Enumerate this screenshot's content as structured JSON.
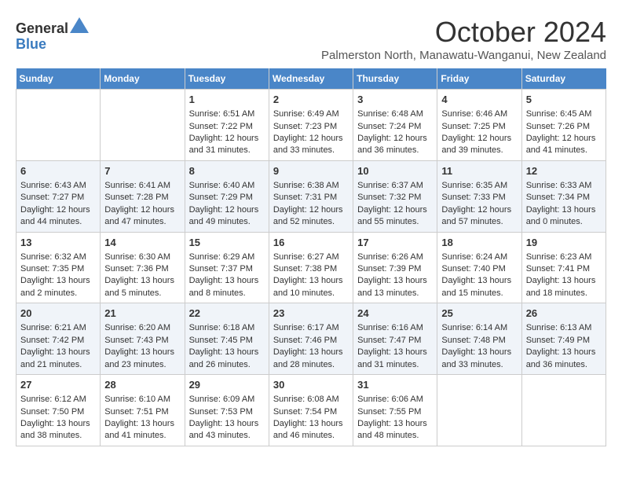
{
  "logo": {
    "general": "General",
    "blue": "Blue"
  },
  "title": "October 2024",
  "location": "Palmerston North, Manawatu-Wanganui, New Zealand",
  "days_of_week": [
    "Sunday",
    "Monday",
    "Tuesday",
    "Wednesday",
    "Thursday",
    "Friday",
    "Saturday"
  ],
  "weeks": [
    [
      {
        "day": "",
        "sunrise": "",
        "sunset": "",
        "daylight": ""
      },
      {
        "day": "",
        "sunrise": "",
        "sunset": "",
        "daylight": ""
      },
      {
        "day": "1",
        "sunrise": "Sunrise: 6:51 AM",
        "sunset": "Sunset: 7:22 PM",
        "daylight": "Daylight: 12 hours and 31 minutes."
      },
      {
        "day": "2",
        "sunrise": "Sunrise: 6:49 AM",
        "sunset": "Sunset: 7:23 PM",
        "daylight": "Daylight: 12 hours and 33 minutes."
      },
      {
        "day": "3",
        "sunrise": "Sunrise: 6:48 AM",
        "sunset": "Sunset: 7:24 PM",
        "daylight": "Daylight: 12 hours and 36 minutes."
      },
      {
        "day": "4",
        "sunrise": "Sunrise: 6:46 AM",
        "sunset": "Sunset: 7:25 PM",
        "daylight": "Daylight: 12 hours and 39 minutes."
      },
      {
        "day": "5",
        "sunrise": "Sunrise: 6:45 AM",
        "sunset": "Sunset: 7:26 PM",
        "daylight": "Daylight: 12 hours and 41 minutes."
      }
    ],
    [
      {
        "day": "6",
        "sunrise": "Sunrise: 6:43 AM",
        "sunset": "Sunset: 7:27 PM",
        "daylight": "Daylight: 12 hours and 44 minutes."
      },
      {
        "day": "7",
        "sunrise": "Sunrise: 6:41 AM",
        "sunset": "Sunset: 7:28 PM",
        "daylight": "Daylight: 12 hours and 47 minutes."
      },
      {
        "day": "8",
        "sunrise": "Sunrise: 6:40 AM",
        "sunset": "Sunset: 7:29 PM",
        "daylight": "Daylight: 12 hours and 49 minutes."
      },
      {
        "day": "9",
        "sunrise": "Sunrise: 6:38 AM",
        "sunset": "Sunset: 7:31 PM",
        "daylight": "Daylight: 12 hours and 52 minutes."
      },
      {
        "day": "10",
        "sunrise": "Sunrise: 6:37 AM",
        "sunset": "Sunset: 7:32 PM",
        "daylight": "Daylight: 12 hours and 55 minutes."
      },
      {
        "day": "11",
        "sunrise": "Sunrise: 6:35 AM",
        "sunset": "Sunset: 7:33 PM",
        "daylight": "Daylight: 12 hours and 57 minutes."
      },
      {
        "day": "12",
        "sunrise": "Sunrise: 6:33 AM",
        "sunset": "Sunset: 7:34 PM",
        "daylight": "Daylight: 13 hours and 0 minutes."
      }
    ],
    [
      {
        "day": "13",
        "sunrise": "Sunrise: 6:32 AM",
        "sunset": "Sunset: 7:35 PM",
        "daylight": "Daylight: 13 hours and 2 minutes."
      },
      {
        "day": "14",
        "sunrise": "Sunrise: 6:30 AM",
        "sunset": "Sunset: 7:36 PM",
        "daylight": "Daylight: 13 hours and 5 minutes."
      },
      {
        "day": "15",
        "sunrise": "Sunrise: 6:29 AM",
        "sunset": "Sunset: 7:37 PM",
        "daylight": "Daylight: 13 hours and 8 minutes."
      },
      {
        "day": "16",
        "sunrise": "Sunrise: 6:27 AM",
        "sunset": "Sunset: 7:38 PM",
        "daylight": "Daylight: 13 hours and 10 minutes."
      },
      {
        "day": "17",
        "sunrise": "Sunrise: 6:26 AM",
        "sunset": "Sunset: 7:39 PM",
        "daylight": "Daylight: 13 hours and 13 minutes."
      },
      {
        "day": "18",
        "sunrise": "Sunrise: 6:24 AM",
        "sunset": "Sunset: 7:40 PM",
        "daylight": "Daylight: 13 hours and 15 minutes."
      },
      {
        "day": "19",
        "sunrise": "Sunrise: 6:23 AM",
        "sunset": "Sunset: 7:41 PM",
        "daylight": "Daylight: 13 hours and 18 minutes."
      }
    ],
    [
      {
        "day": "20",
        "sunrise": "Sunrise: 6:21 AM",
        "sunset": "Sunset: 7:42 PM",
        "daylight": "Daylight: 13 hours and 21 minutes."
      },
      {
        "day": "21",
        "sunrise": "Sunrise: 6:20 AM",
        "sunset": "Sunset: 7:43 PM",
        "daylight": "Daylight: 13 hours and 23 minutes."
      },
      {
        "day": "22",
        "sunrise": "Sunrise: 6:18 AM",
        "sunset": "Sunset: 7:45 PM",
        "daylight": "Daylight: 13 hours and 26 minutes."
      },
      {
        "day": "23",
        "sunrise": "Sunrise: 6:17 AM",
        "sunset": "Sunset: 7:46 PM",
        "daylight": "Daylight: 13 hours and 28 minutes."
      },
      {
        "day": "24",
        "sunrise": "Sunrise: 6:16 AM",
        "sunset": "Sunset: 7:47 PM",
        "daylight": "Daylight: 13 hours and 31 minutes."
      },
      {
        "day": "25",
        "sunrise": "Sunrise: 6:14 AM",
        "sunset": "Sunset: 7:48 PM",
        "daylight": "Daylight: 13 hours and 33 minutes."
      },
      {
        "day": "26",
        "sunrise": "Sunrise: 6:13 AM",
        "sunset": "Sunset: 7:49 PM",
        "daylight": "Daylight: 13 hours and 36 minutes."
      }
    ],
    [
      {
        "day": "27",
        "sunrise": "Sunrise: 6:12 AM",
        "sunset": "Sunset: 7:50 PM",
        "daylight": "Daylight: 13 hours and 38 minutes."
      },
      {
        "day": "28",
        "sunrise": "Sunrise: 6:10 AM",
        "sunset": "Sunset: 7:51 PM",
        "daylight": "Daylight: 13 hours and 41 minutes."
      },
      {
        "day": "29",
        "sunrise": "Sunrise: 6:09 AM",
        "sunset": "Sunset: 7:53 PM",
        "daylight": "Daylight: 13 hours and 43 minutes."
      },
      {
        "day": "30",
        "sunrise": "Sunrise: 6:08 AM",
        "sunset": "Sunset: 7:54 PM",
        "daylight": "Daylight: 13 hours and 46 minutes."
      },
      {
        "day": "31",
        "sunrise": "Sunrise: 6:06 AM",
        "sunset": "Sunset: 7:55 PM",
        "daylight": "Daylight: 13 hours and 48 minutes."
      },
      {
        "day": "",
        "sunrise": "",
        "sunset": "",
        "daylight": ""
      },
      {
        "day": "",
        "sunrise": "",
        "sunset": "",
        "daylight": ""
      }
    ]
  ]
}
